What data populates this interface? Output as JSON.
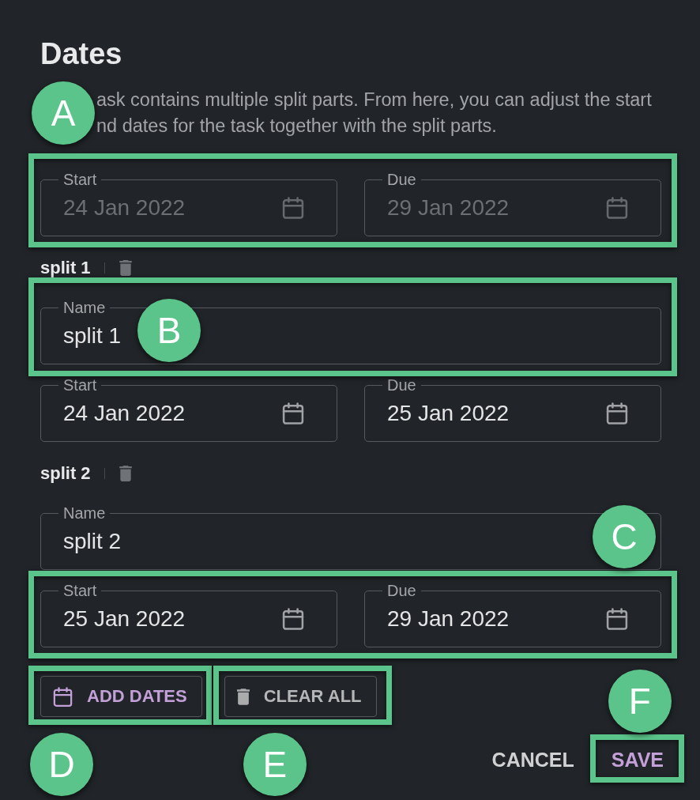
{
  "dialog": {
    "title": "Dates",
    "description_lines": [
      "ask contains multiple split parts. From here, you can adjust the start",
      "nd dates for the task together with the split parts."
    ]
  },
  "task_dates": {
    "annotation": "A",
    "fields": [
      {
        "label": "Start",
        "value": "24 Jan 2022",
        "disabled": true
      },
      {
        "label": "Due",
        "value": "29 Jan 2022",
        "disabled": true
      }
    ]
  },
  "splits": [
    {
      "title": "split 1",
      "name_field": {
        "label": "Name",
        "value": "split 1",
        "annotation": "B"
      },
      "date_fields": [
        {
          "label": "Start",
          "value": "24 Jan 2022",
          "disabled": false
        },
        {
          "label": "Due",
          "value": "25 Jan 2022",
          "disabled": false
        }
      ]
    },
    {
      "title": "split 2",
      "name_field": {
        "label": "Name",
        "value": "split 2"
      },
      "dates_annotation": "C",
      "date_fields": [
        {
          "label": "Start",
          "value": "25 Jan 2022",
          "disabled": false
        },
        {
          "label": "Due",
          "value": "29 Jan 2022",
          "disabled": false
        }
      ]
    }
  ],
  "actions": [
    {
      "kind": "add",
      "label": "ADD DATES",
      "annotation": "D"
    },
    {
      "kind": "clear",
      "label": "CLEAR ALL",
      "annotation": "E"
    }
  ],
  "footer_buttons": [
    {
      "kind": "text",
      "label": "CANCEL"
    },
    {
      "kind": "primary",
      "label": "SAVE",
      "annotation": "F"
    }
  ]
}
